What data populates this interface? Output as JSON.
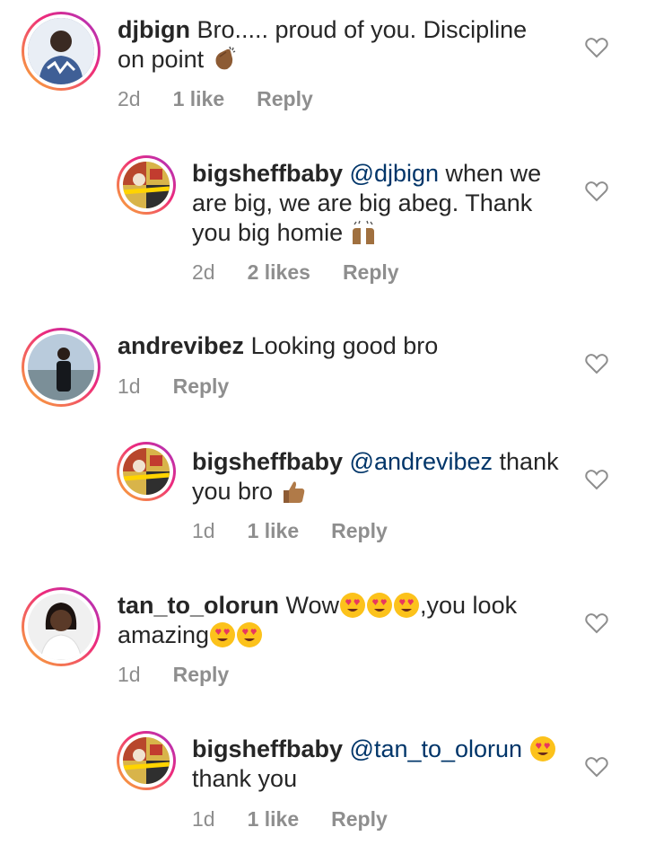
{
  "comments": [
    {
      "username": "djbign",
      "text_before": " Bro..... proud of you. Discipline on point",
      "emoji": "clapping-hands",
      "time": "2d",
      "likes": "1 like",
      "reply_label": "Reply",
      "avatar_bg": "#6b7da8"
    },
    {
      "username": "bigsheffbaby",
      "mention": "@djbign",
      "text_before": " when we are big, we are big abeg. Thank you big homie",
      "emoji": "raising-hands",
      "time": "2d",
      "likes": "2 likes",
      "reply_label": "Reply",
      "avatar_bg": "#d4a23a"
    },
    {
      "username": "andrevibez",
      "text_before": " Looking good bro",
      "time": "1d",
      "reply_label": "Reply",
      "avatar_bg": "#9fb4c7"
    },
    {
      "username": "bigsheffbaby",
      "mention": "@andrevibez",
      "text_before": " thank you bro",
      "emoji": "thumbs-up",
      "time": "1d",
      "likes": "1 like",
      "reply_label": "Reply",
      "avatar_bg": "#d4a23a"
    },
    {
      "username": "tan_to_olorun",
      "text_before": " Wow",
      "text_middle": ",you look amazing",
      "emoji": "heart-eyes",
      "time": "1d",
      "reply_label": "Reply",
      "avatar_bg": "#e8e8e8"
    },
    {
      "username": "bigsheffbaby",
      "mention": "@tan_to_olorun",
      "text_after": "thank you",
      "emoji": "heart-eyes",
      "time": "1d",
      "likes": "1 like",
      "reply_label": "Reply",
      "avatar_bg": "#d4a23a"
    }
  ],
  "colors": {
    "text": "#262626",
    "meta": "#8e8e8e",
    "mention": "#003569",
    "heart_outline": "#8e8e8e"
  }
}
